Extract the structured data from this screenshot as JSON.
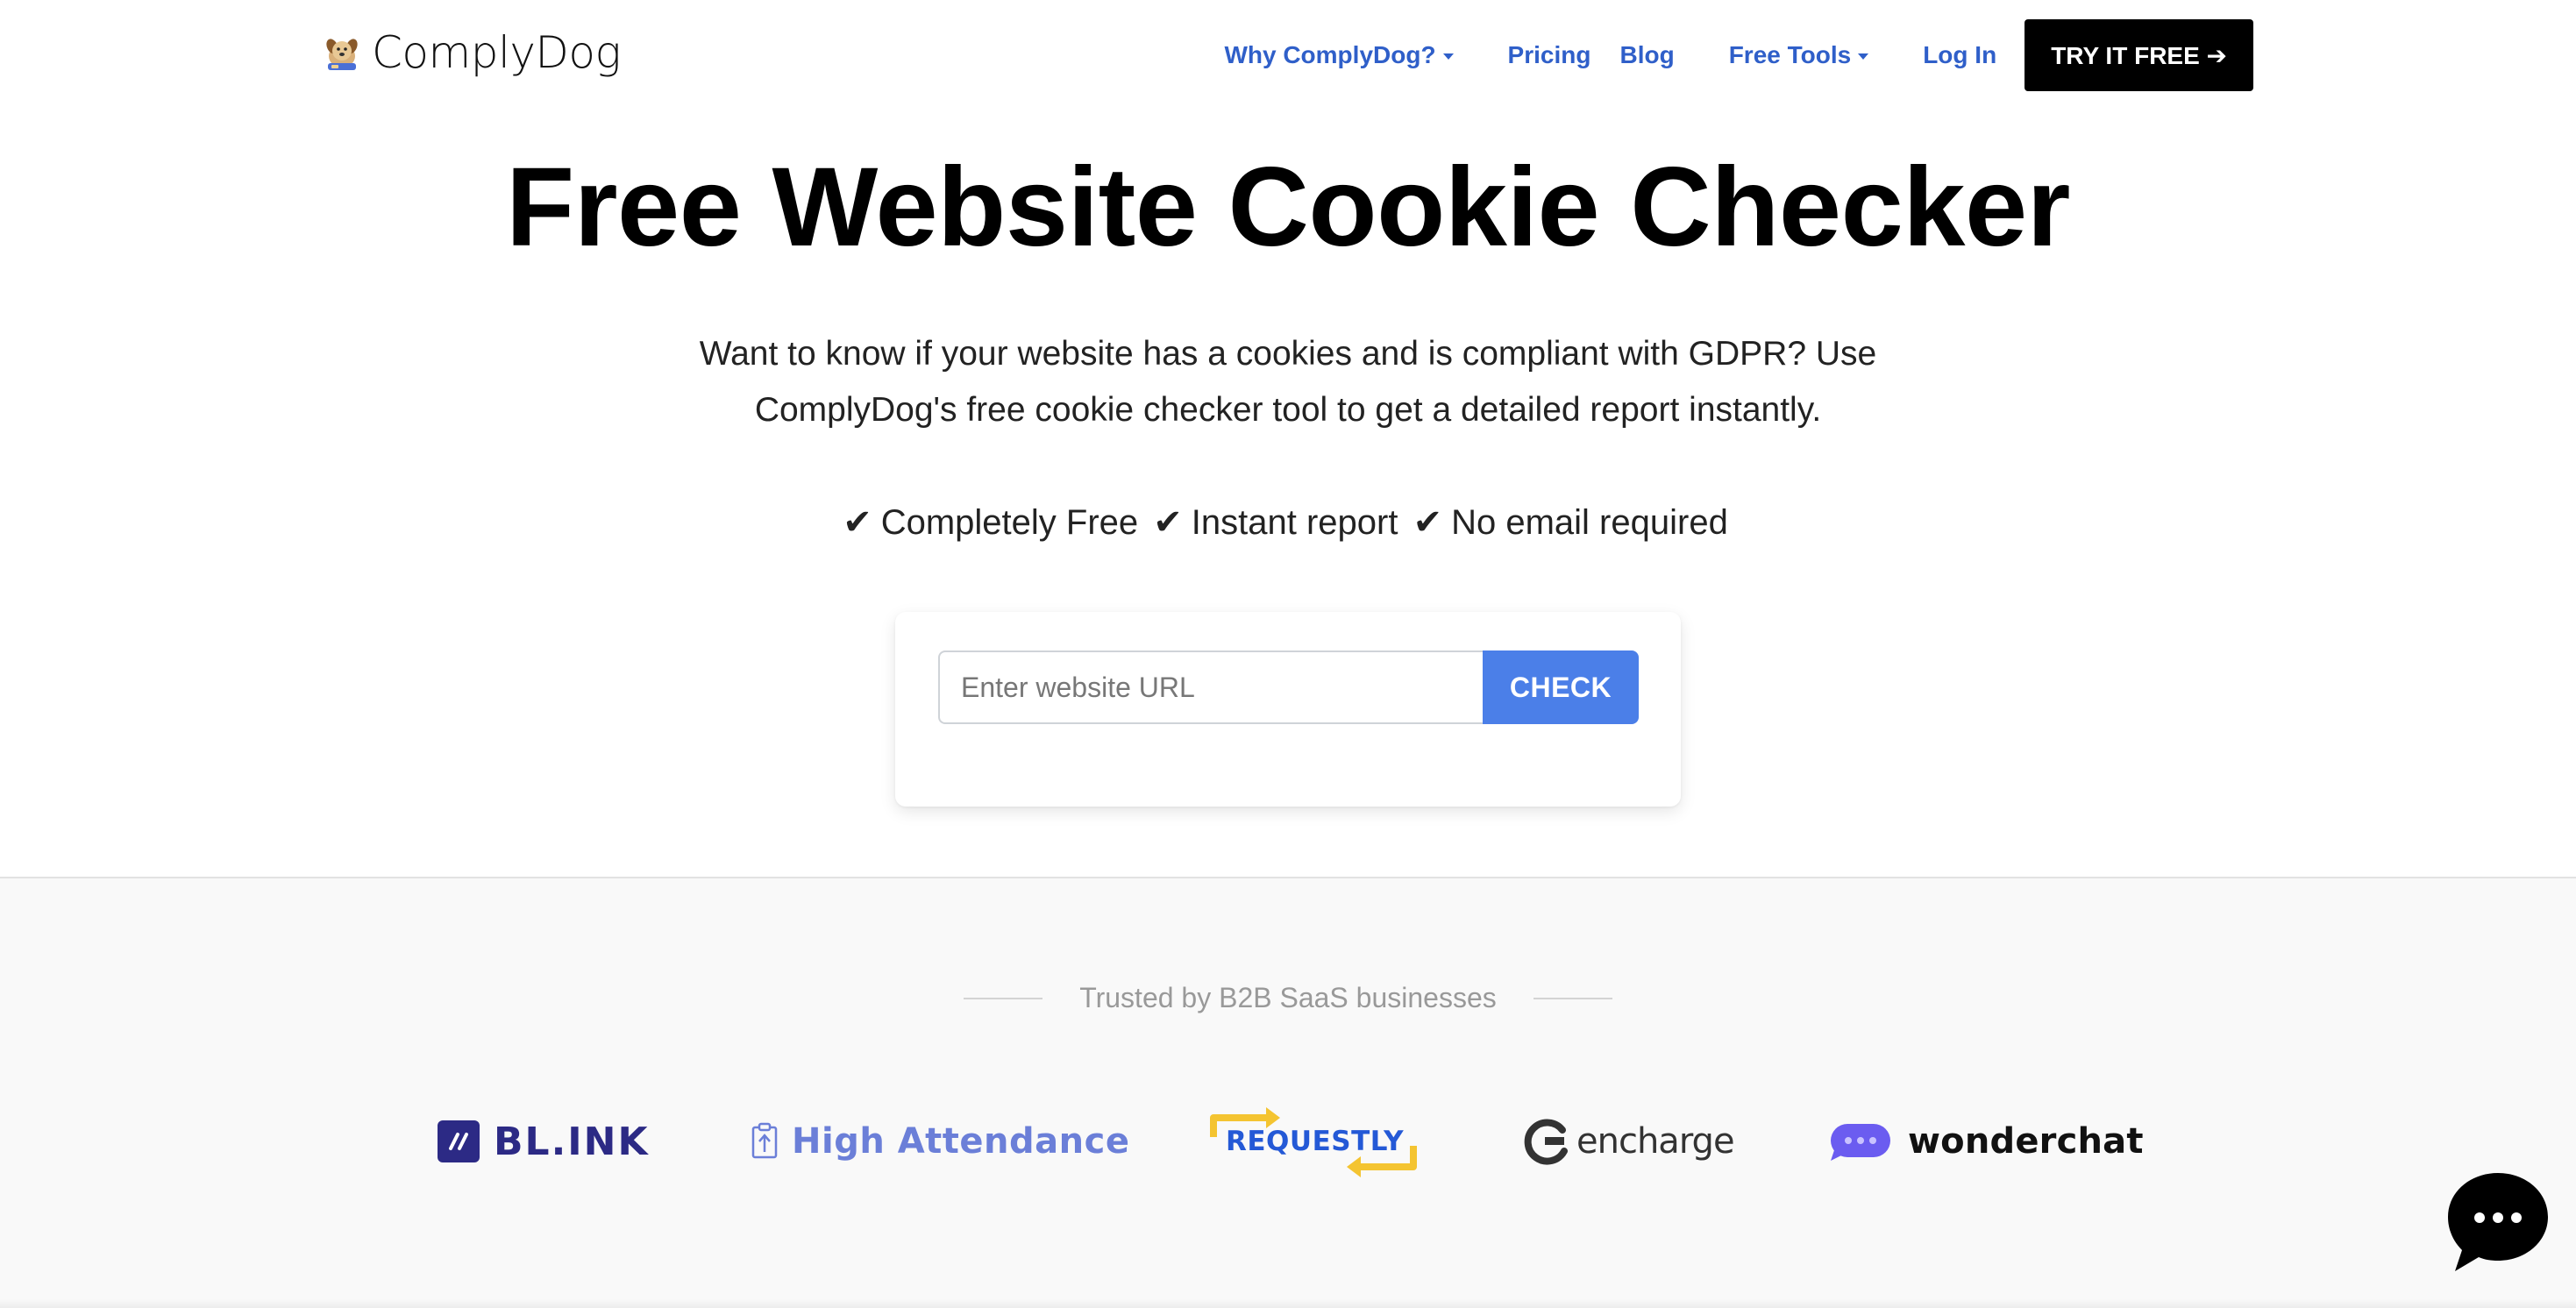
{
  "brand": {
    "name": "ComplyDog"
  },
  "nav": {
    "why": "Why ComplyDog?",
    "pricing": "Pricing",
    "blog": "Blog",
    "free_tools": "Free Tools",
    "login": "Log In",
    "try_free": "TRY IT FREE ➔"
  },
  "hero": {
    "title": "Free Website Cookie Checker",
    "subtitle_line1": "Want to know if your website has a cookies and is compliant with GDPR? Use",
    "subtitle_line2": "ComplyDog's free cookie checker tool to get a detailed report instantly.",
    "benefits": [
      "Completely Free",
      "Instant report",
      "No email required"
    ],
    "check_mark": "✔"
  },
  "checker": {
    "url_placeholder": "Enter website URL",
    "url_value": "",
    "button_label": "CHECK"
  },
  "trust": {
    "label": "Trusted by B2B SaaS businesses",
    "logos": [
      "BL.INK",
      "High Attendance",
      "REQUESTLY",
      "encharge",
      "wonderchat"
    ]
  },
  "colors": {
    "link_blue": "#2f5fc9",
    "check_button": "#4b7fe8",
    "try_button": "#000000",
    "trust_bg": "#f9f9f9"
  },
  "icons": {
    "brand": "dog-logo-icon",
    "chat": "chat-bubble-icon",
    "caret": "caret-down-icon"
  }
}
